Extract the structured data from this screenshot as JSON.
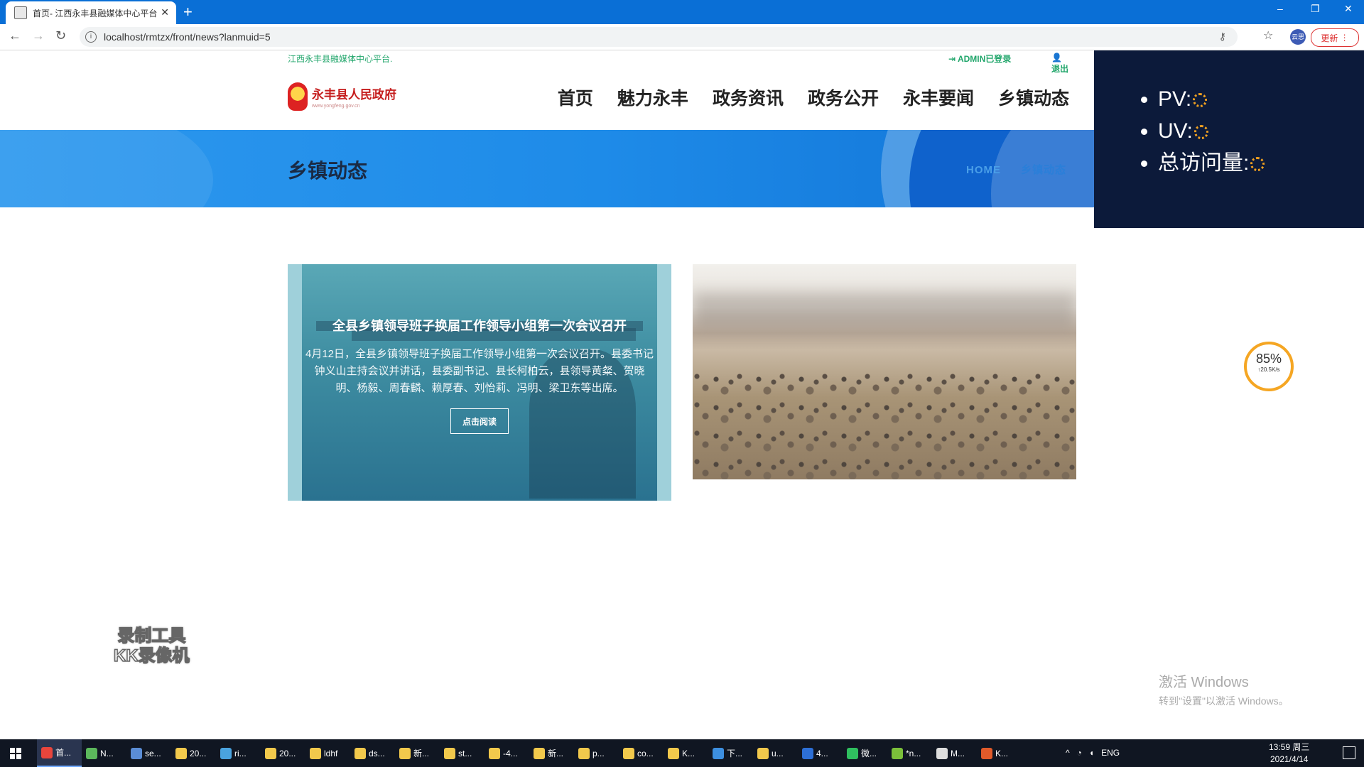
{
  "browser": {
    "tab_title": "首页- 江西永丰县融媒体中心平台",
    "new_tab": "+",
    "close": "✕",
    "window_controls": [
      "–",
      "❐",
      "✕"
    ],
    "url": "localhost/rmtzx/front/news?lanmuid=5",
    "avatar_label": "云思",
    "update_button": "更新"
  },
  "site": {
    "top_text": "江西永丰县融媒体中心平台.",
    "login_status": "ADMIN已登录",
    "logout": "退出",
    "logo_cn": "永丰县人民政府",
    "logo_en": "www.yongfeng.gov.cn",
    "nav": [
      "首页",
      "魅力永丰",
      "政务资讯",
      "政务公开",
      "永丰要闻",
      "乡镇动态"
    ],
    "page_title": "乡镇动态",
    "breadcrumb": [
      "HOME",
      "乡镇动态"
    ]
  },
  "news": [
    {
      "title": "全县乡镇领导班子换届工作领导小组第一次会议召开",
      "summary": "4月12日，全县乡镇领导班子换届工作领导小组第一次会议召开。县委书记钟义山主持会议并讲话，县委副书记、县长柯柏云，县领导黄粲、贺晓明、杨毅、周春麟、赖厚春、刘怡莉、冯明、梁卫东等出席。",
      "read_more": "点击阅读"
    }
  ],
  "stats": {
    "pv_label": "PV:",
    "uv_label": "UV:",
    "total_label": "总访问量:"
  },
  "speed_widget": {
    "percent": "85%",
    "rate": "↑20.5K/s"
  },
  "recorder": {
    "line1": "录制工具",
    "line2": "KK录像机"
  },
  "activation": {
    "line1": "激活 Windows",
    "line2": "转到\"设置\"以激活 Windows。"
  },
  "taskbar": {
    "tasks": [
      {
        "label": "首...",
        "color": "#e8453c"
      },
      {
        "label": "N...",
        "color": "#5cb85c"
      },
      {
        "label": "se...",
        "color": "#5b8dd6"
      },
      {
        "label": "20...",
        "color": "#f2c94c"
      },
      {
        "label": "ri...",
        "color": "#4aa3df"
      },
      {
        "label": "20...",
        "color": "#f2c94c"
      },
      {
        "label": "ldhf",
        "color": "#f2c94c"
      },
      {
        "label": "ds...",
        "color": "#f2c94c"
      },
      {
        "label": "新...",
        "color": "#f2c94c"
      },
      {
        "label": "st...",
        "color": "#f2c94c"
      },
      {
        "label": "-4...",
        "color": "#f2c94c"
      },
      {
        "label": "新...",
        "color": "#f2c94c"
      },
      {
        "label": "p...",
        "color": "#f2c94c"
      },
      {
        "label": "co...",
        "color": "#f2c94c"
      },
      {
        "label": "K...",
        "color": "#f2c94c"
      },
      {
        "label": "下...",
        "color": "#3d8fe0"
      },
      {
        "label": "u...",
        "color": "#f2c94c"
      },
      {
        "label": "4...",
        "color": "#2d6fd6"
      },
      {
        "label": "微...",
        "color": "#2fbf5f"
      },
      {
        "label": "*n...",
        "color": "#7bbf3a"
      },
      {
        "label": "M...",
        "color": "#dddddd"
      },
      {
        "label": "K...",
        "color": "#e05a2a"
      }
    ],
    "lang": "ENG",
    "time": "13:59 周三",
    "date": "2021/4/14"
  }
}
